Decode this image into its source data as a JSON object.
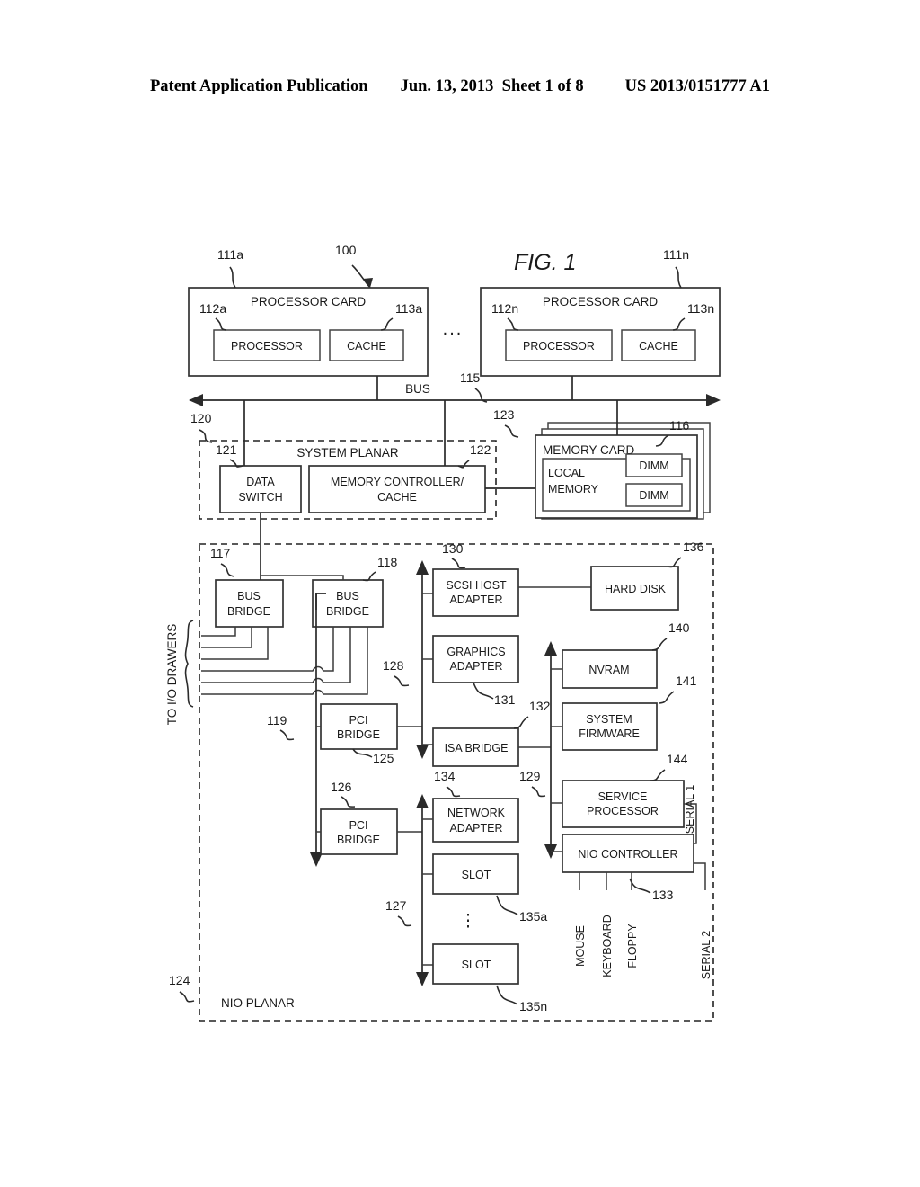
{
  "header": {
    "publication": "Patent Application Publication",
    "date_sheet": "Jun. 13, 2013  Sheet 1 of 8",
    "patent_number": "US 2013/0151777 A1"
  },
  "figure": {
    "title": "FIG. 1",
    "system_ref": "100"
  },
  "processor_cards": [
    {
      "card_label": "PROCESSOR CARD",
      "card_ref": "111a",
      "processor_label": "PROCESSOR",
      "processor_ref": "112a",
      "cache_label": "CACHE",
      "cache_ref": "113a"
    },
    {
      "card_label": "PROCESSOR CARD",
      "card_ref": "111n",
      "processor_label": "PROCESSOR",
      "processor_ref": "112n",
      "cache_label": "CACHE",
      "cache_ref": "113n"
    }
  ],
  "ellipsis_between_cards": "...",
  "bus": {
    "label": "BUS",
    "ref": "115"
  },
  "system_planar": {
    "label": "SYSTEM PLANAR",
    "ref": "120",
    "data_switch": {
      "line1": "DATA",
      "line2": "SWITCH",
      "ref": "121"
    },
    "memory_controller": {
      "line1": "MEMORY CONTROLLER/",
      "line2": "CACHE",
      "ref": "122"
    }
  },
  "memory_card": {
    "label": "MEMORY CARD",
    "ref": "123",
    "local_memory": {
      "line1": "LOCAL",
      "line2": "MEMORY"
    },
    "dimm_ref": "116",
    "dimms": [
      "DIMM",
      "DIMM"
    ]
  },
  "nio_planar": {
    "label": "NIO PLANAR",
    "ref": "124",
    "io_drawers_label": "TO I/O DRAWERS"
  },
  "bridges": {
    "bus_bridge_1": {
      "line1": "BUS",
      "line2": "BRIDGE",
      "ref": "117"
    },
    "bus_bridge_2": {
      "line1": "BUS",
      "line2": "BRIDGE",
      "ref": "118"
    },
    "internal_bus_ref": "119",
    "pci_bridge_1": {
      "line1": "PCI",
      "line2": "BRIDGE",
      "ref": "125"
    },
    "pci_bridge_2": {
      "line1": "PCI",
      "line2": "BRIDGE",
      "ref": "126"
    },
    "pci_bus_upper_ref": "128",
    "pci_bus_lower_ref": "127",
    "isa_bus_ref": "129"
  },
  "adapters": {
    "scsi_host_adapter": {
      "line1": "SCSI HOST",
      "line2": "ADAPTER",
      "ref": "130"
    },
    "graphics_adapter": {
      "line1": "GRAPHICS",
      "line2": "ADAPTER",
      "ref": "131"
    },
    "isa_bridge": {
      "label": "ISA BRIDGE",
      "ref": "132"
    },
    "network_adapter": {
      "line1": "NETWORK",
      "line2": "ADAPTER",
      "ref": "134"
    },
    "hard_disk": {
      "label": "HARD DISK",
      "ref": "136"
    }
  },
  "isa_devices": {
    "nvram": {
      "label": "NVRAM",
      "ref": "140"
    },
    "system_firmware": {
      "line1": "SYSTEM",
      "line2": "FIRMWARE",
      "ref": "141"
    },
    "service_processor": {
      "line1": "SERVICE",
      "line2": "PROCESSOR",
      "ref": "144"
    },
    "nio_controller": {
      "label": "NIO CONTROLLER",
      "ref": "133"
    }
  },
  "nio_ports": [
    "MOUSE",
    "KEYBOARD",
    "FLOPPY"
  ],
  "serial_ports": [
    "SERIAL 1",
    "SERIAL 2"
  ],
  "slots": [
    {
      "label": "SLOT",
      "ref": "135a"
    },
    {
      "label": "SLOT",
      "ref": "135n"
    }
  ],
  "slot_ellipsis": "⋮",
  "colors": {
    "line": "#2a2a2a",
    "text": "#1a1a1a",
    "background": "#ffffff"
  }
}
